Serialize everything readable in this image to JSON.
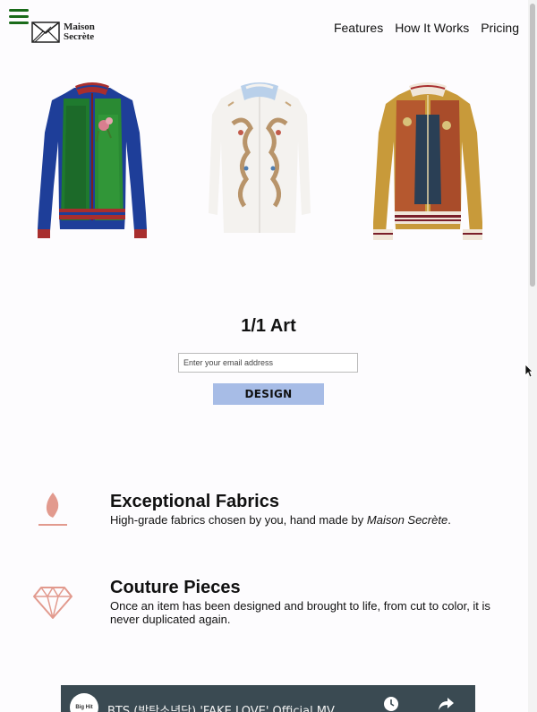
{
  "header": {
    "logo_line1": "Maison",
    "logo_line2": "Secrète",
    "nav": [
      "Features",
      "How It Works",
      "Pricing"
    ]
  },
  "hero": {
    "title": "1/1 Art",
    "email_placeholder": "Enter your email address",
    "cta_label": "DESIGN"
  },
  "features": [
    {
      "icon": "flame-icon",
      "title": "Exceptional Fabrics",
      "desc_prefix": "High-grade fabrics chosen by you, hand made by ",
      "desc_emphasis": "Maison Secrète",
      "desc_suffix": "."
    },
    {
      "icon": "diamond-icon",
      "title": "Couture Pieces",
      "desc": "Once an item has been designed and brought to life, from cut to color, it is never duplicated again."
    }
  ],
  "video": {
    "channel": "Big Hit",
    "title": "BTS (방탄소년단) 'FAKE LOVE' Official MV"
  },
  "colors": {
    "menu": "#1a6b1a",
    "cta": "#a7bce6",
    "icon_accent": "#e29a8e"
  }
}
